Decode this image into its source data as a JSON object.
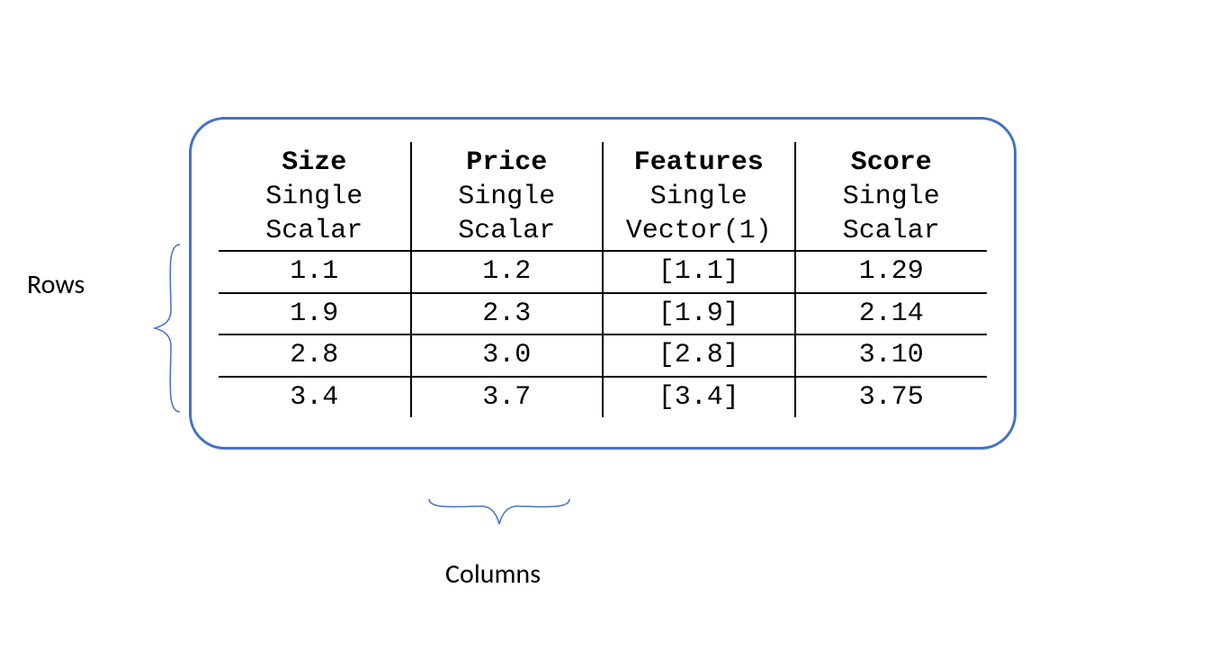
{
  "labels": {
    "rows": "Rows",
    "columns": "Columns"
  },
  "table": {
    "columns": [
      {
        "name": "Size",
        "kind": "Single",
        "type": "Scalar"
      },
      {
        "name": "Price",
        "kind": "Single",
        "type": "Scalar"
      },
      {
        "name": "Features",
        "kind": "Single",
        "type": "Vector(1)"
      },
      {
        "name": "Score",
        "kind": "Single",
        "type": "Scalar"
      }
    ],
    "rows": [
      {
        "size": "1.1",
        "price": "1.2",
        "features": "[1.1]",
        "score": "1.29"
      },
      {
        "size": "1.9",
        "price": "2.3",
        "features": "[1.9]",
        "score": "2.14"
      },
      {
        "size": "2.8",
        "price": "3.0",
        "features": "[2.8]",
        "score": "3.10"
      },
      {
        "size": "3.4",
        "price": "3.7",
        "features": "[3.4]",
        "score": "3.75"
      }
    ]
  },
  "colors": {
    "border": "#4472C4"
  }
}
